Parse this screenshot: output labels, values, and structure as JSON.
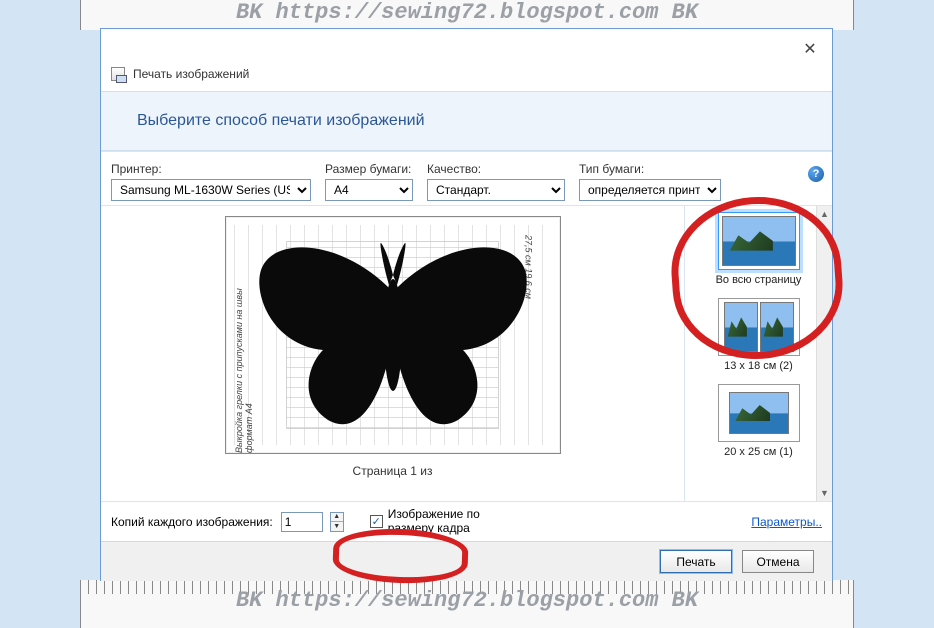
{
  "watermark_top": "BK  https://sewing72.blogspot.com BK",
  "watermark_bottom": "BK  https://sewing72.blogspot.com BK",
  "dialog": {
    "title": "Печать изображений",
    "close": "✕",
    "instruction": "Выберите способ печати изображений",
    "printer_label": "Принтер:",
    "printer_value": "Samsung ML-1630W Series (USB0",
    "paper_label": "Размер бумаги:",
    "paper_value": "A4",
    "quality_label": "Качество:",
    "quality_value": "Стандарт.",
    "papertype_label": "Тип бумаги:",
    "papertype_value": "определяется принте",
    "help": "?",
    "preview_side_left": "Выкройка грелки\nс припусками на швы\nформат А4",
    "preview_side_right": "27,5 см\n19,6 см",
    "page_counter": "Страница 1 из",
    "layouts": [
      {
        "label": "Во всю страницу"
      },
      {
        "label": "13 x 18 см (2)"
      },
      {
        "label": "20 x 25 см (1)"
      }
    ],
    "copies_label": "Копий каждого изображения:",
    "copies_value": "1",
    "fit_label_line1": "Изображение по",
    "fit_label_line2": "размеру кадра",
    "checkbox_mark": "✓",
    "params_link": "Параметры..",
    "btn_print": "Печать",
    "btn_cancel": "Отмена"
  }
}
